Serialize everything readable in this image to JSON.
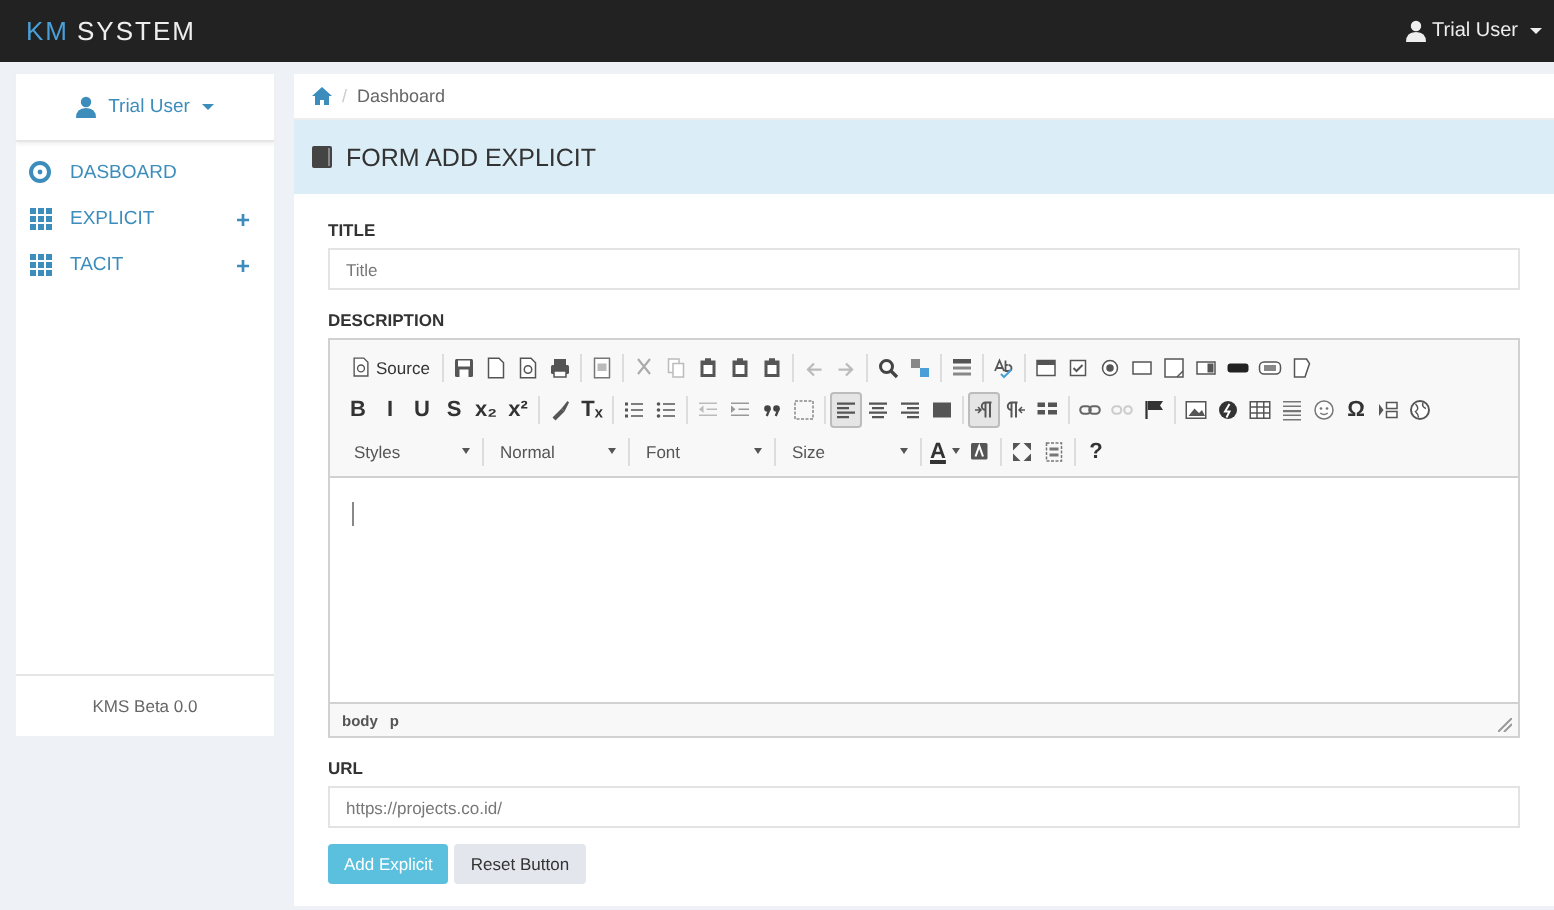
{
  "navbar": {
    "brand_accent": "KM",
    "brand_rest": "SYSTEM",
    "user": "Trial User"
  },
  "sidebar": {
    "user": "Trial User",
    "items": [
      {
        "kind": "dashboard",
        "label": "DASBOARD"
      },
      {
        "kind": "grid",
        "label": "EXPLICIT",
        "expand": "+"
      },
      {
        "kind": "grid",
        "label": "TACIT",
        "expand": "+"
      }
    ],
    "footer": "KMS Beta 0.0"
  },
  "breadcrumb": {
    "separator": "/",
    "items": [
      "Dashboard"
    ]
  },
  "panel_title": "FORM ADD EXPLICIT",
  "form": {
    "title_label": "TITLE",
    "title_placeholder": "Title",
    "description_label": "DESCRIPTION",
    "editor": {
      "toolbar": [
        [
          [
            {
              "kind": "source",
              "text": "Source"
            }
          ],
          [
            {
              "kind": "icon",
              "on": false
            },
            {
              "kind": "icon",
              "on": false
            },
            {
              "kind": "icon",
              "on": false
            },
            {
              "kind": "icon",
              "on": false
            }
          ],
          [
            {
              "kind": "icon",
              "on": false
            }
          ],
          [
            {
              "kind": "icon",
              "on": false
            },
            {
              "kind": "icon",
              "on": false
            },
            {
              "kind": "icon",
              "on": false
            },
            {
              "kind": "icon",
              "on": false
            },
            {
              "kind": "icon",
              "on": false
            }
          ],
          [
            {
              "kind": "icon",
              "on": false
            },
            {
              "kind": "icon",
              "on": false
            }
          ],
          [
            {
              "kind": "icon",
              "on": false
            },
            {
              "kind": "icon",
              "on": false
            }
          ],
          [
            {
              "kind": "icon",
              "on": false
            }
          ],
          [
            {
              "kind": "icon",
              "on": false
            }
          ],
          [
            {
              "kind": "icon",
              "on": false
            },
            {
              "kind": "icon",
              "on": false
            },
            {
              "kind": "icon",
              "on": false
            },
            {
              "kind": "icon",
              "on": false
            },
            {
              "kind": "icon",
              "on": false
            },
            {
              "kind": "icon",
              "on": false
            },
            {
              "kind": "icon",
              "on": false
            },
            {
              "kind": "icon",
              "on": false
            },
            {
              "kind": "icon",
              "on": false
            }
          ]
        ],
        [
          [
            {
              "kind": "label",
              "text": "B"
            },
            {
              "kind": "label",
              "text": "I"
            },
            {
              "kind": "label",
              "text": "U"
            },
            {
              "kind": "label",
              "text": "S"
            },
            {
              "kind": "label",
              "text": "x₂"
            },
            {
              "kind": "label",
              "text": "x²"
            }
          ],
          [
            {
              "kind": "icon",
              "on": false
            },
            {
              "kind": "label",
              "text": "Tₓ"
            }
          ],
          [
            {
              "kind": "icon",
              "on": false
            },
            {
              "kind": "icon",
              "on": false
            }
          ],
          [
            {
              "kind": "icon",
              "on": false
            },
            {
              "kind": "icon",
              "on": false
            },
            {
              "kind": "icon",
              "on": false
            },
            {
              "kind": "icon",
              "on": false
            }
          ],
          [
            {
              "kind": "icon",
              "on": true
            },
            {
              "kind": "icon",
              "on": false
            },
            {
              "kind": "icon",
              "on": false
            },
            {
              "kind": "icon",
              "on": false
            }
          ],
          [
            {
              "kind": "icon",
              "on": true
            },
            {
              "kind": "icon",
              "on": false
            },
            {
              "kind": "icon",
              "on": false
            }
          ],
          [
            {
              "kind": "icon",
              "on": false
            },
            {
              "kind": "icon",
              "on": false
            },
            {
              "kind": "icon",
              "on": false
            }
          ],
          [
            {
              "kind": "icon",
              "on": false
            },
            {
              "kind": "icon",
              "on": false
            },
            {
              "kind": "icon",
              "on": false
            },
            {
              "kind": "icon",
              "on": false
            },
            {
              "kind": "icon",
              "on": false
            },
            {
              "kind": "label",
              "text": "Ω"
            },
            {
              "kind": "icon",
              "on": false
            },
            {
              "kind": "icon",
              "on": false
            }
          ]
        ],
        [
          [
            {
              "kind": "combo",
              "text": "Styles"
            }
          ],
          [
            {
              "kind": "combo",
              "text": "Normal"
            }
          ],
          [
            {
              "kind": "combo",
              "text": "Font"
            }
          ],
          [
            {
              "kind": "combo",
              "text": "Size"
            }
          ],
          [
            {
              "kind": "color",
              "text": "A"
            },
            {
              "kind": "icon",
              "on": false
            }
          ],
          [
            {
              "kind": "icon",
              "on": false
            },
            {
              "kind": "icon",
              "on": false
            }
          ],
          [
            {
              "kind": "label",
              "text": "?"
            }
          ]
        ]
      ],
      "path": [
        "body",
        "p"
      ]
    },
    "url_label": "URL",
    "url_placeholder": "https://projects.co.id/",
    "buttons": [
      {
        "kind": "primary",
        "label": "Add Explicit"
      },
      {
        "kind": "default",
        "label": "Reset Button"
      }
    ]
  }
}
